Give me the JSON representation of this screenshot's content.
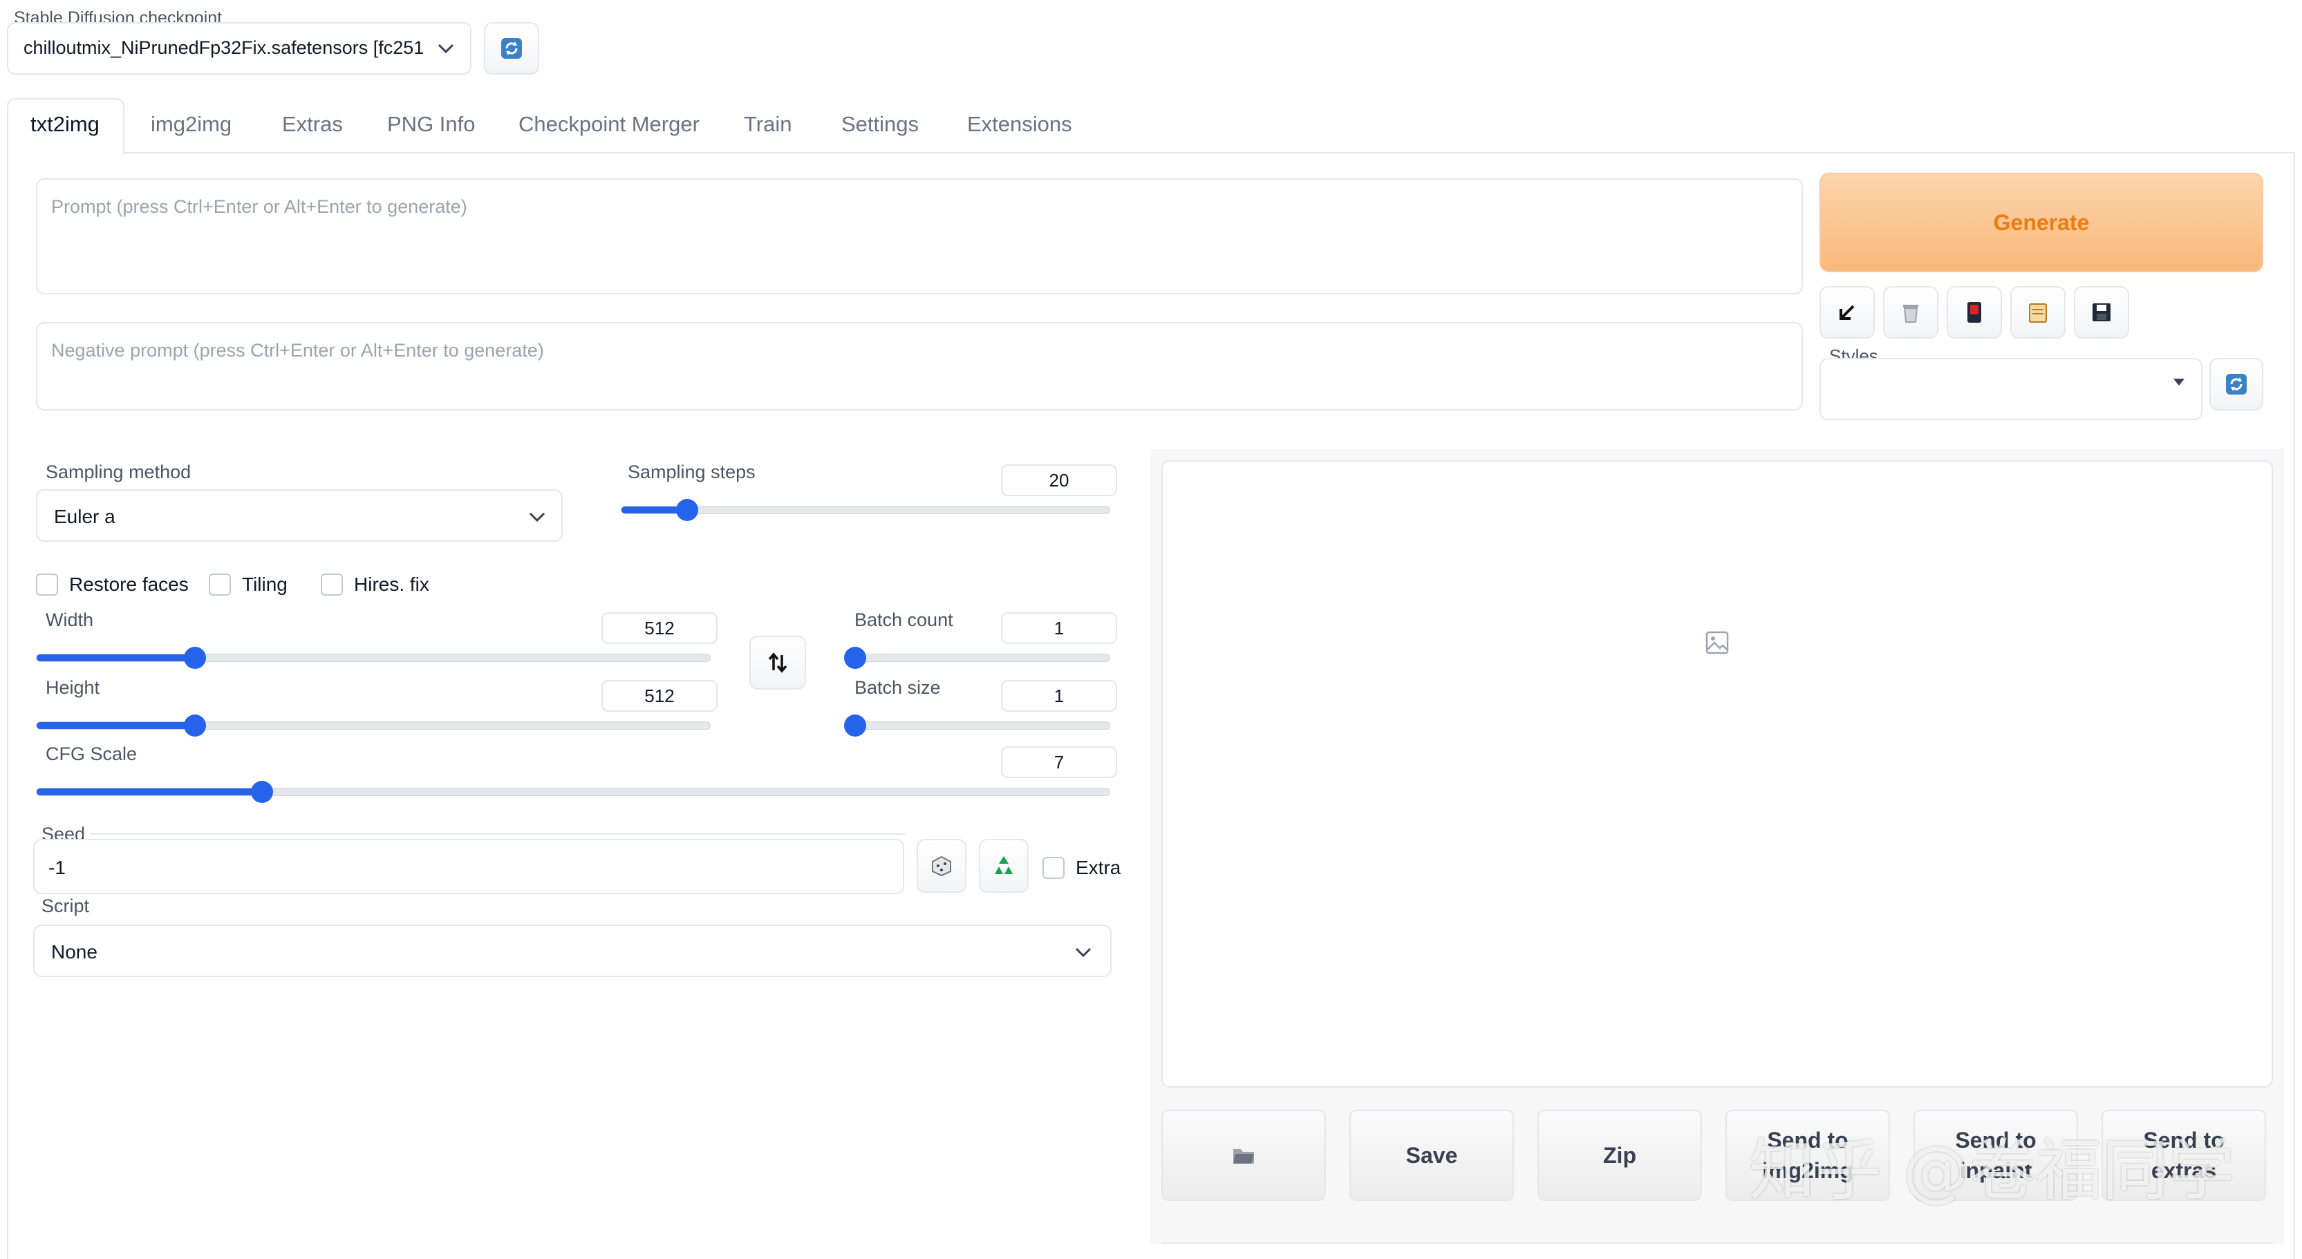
{
  "checkpoint": {
    "label": "Stable Diffusion checkpoint",
    "value": "chilloutmix_NiPrunedFp32Fix.safetensors [fc251"
  },
  "tabs": [
    {
      "label": "txt2img",
      "active": true
    },
    {
      "label": "img2img"
    },
    {
      "label": "Extras"
    },
    {
      "label": "PNG Info"
    },
    {
      "label": "Checkpoint Merger"
    },
    {
      "label": "Train"
    },
    {
      "label": "Settings"
    },
    {
      "label": "Extensions"
    }
  ],
  "prompt": {
    "placeholder": "Prompt (press Ctrl+Enter or Alt+Enter to generate)"
  },
  "negative_prompt": {
    "placeholder": "Negative prompt (press Ctrl+Enter or Alt+Enter to generate)"
  },
  "generate": {
    "label": "Generate"
  },
  "tool_icons": [
    "arrow-down-left-icon",
    "trash-icon",
    "red-card-icon",
    "clipboard-icon",
    "floppy-disk-icon"
  ],
  "styles": {
    "label": "Styles",
    "value": ""
  },
  "sampling_method": {
    "label": "Sampling method",
    "value": "Euler a"
  },
  "sampling_steps": {
    "label": "Sampling steps",
    "value": "20",
    "fraction": 0.135
  },
  "checkboxes": {
    "restore_faces": "Restore faces",
    "tiling": "Tiling",
    "hires_fix": "Hires. fix"
  },
  "width": {
    "label": "Width",
    "value": "512",
    "fraction": 0.235
  },
  "height": {
    "label": "Height",
    "value": "512",
    "fraction": 0.235
  },
  "batch_count": {
    "label": "Batch count",
    "value": "1",
    "fraction": 0.0
  },
  "batch_size": {
    "label": "Batch size",
    "value": "1",
    "fraction": 0.0
  },
  "cfg_scale": {
    "label": "CFG Scale",
    "value": "7",
    "fraction": 0.21
  },
  "seed": {
    "label": "Seed",
    "value": "-1",
    "extra_label": "Extra"
  },
  "script": {
    "label": "Script",
    "value": "None"
  },
  "output_buttons": {
    "save": "Save",
    "zip": "Zip",
    "send_img2img": "Send to img2img",
    "send_inpaint": "Send to inpaint",
    "send_extras": "Send to extras"
  },
  "watermark": "知乎 @卷福同学",
  "colors": {
    "accent": "#2563eb",
    "generate_bg": "#fbc99a",
    "generate_text": "#ea7c12"
  }
}
